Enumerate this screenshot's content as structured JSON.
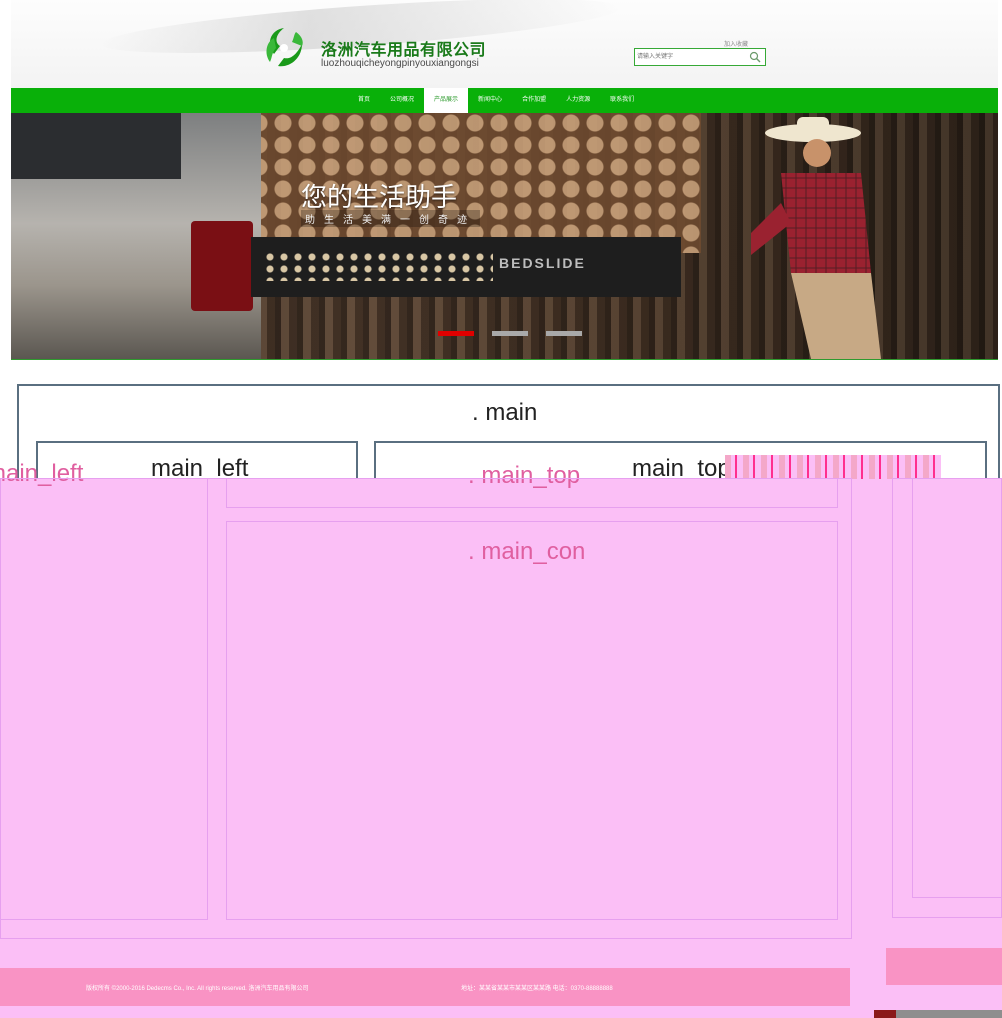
{
  "header": {
    "company_cn": "洛洲汽车用品有限公司",
    "company_en": "luozhouqicheyongpinyouxiangongsi",
    "top_link": "加入收藏",
    "search_placeholder": "请输入关键字"
  },
  "nav": {
    "items": [
      "首页",
      "公司概况",
      "产品展示",
      "新闻中心",
      "合作加盟",
      "人力资源",
      "联系我们"
    ],
    "active_index": 2
  },
  "banner": {
    "slogan": "您的生活助手",
    "subslogan": "助生活美满一创奇迹",
    "product_brand": "BEDSLIDE",
    "slides": 3,
    "active_slide": 0
  },
  "debug": {
    "main_label": ". main",
    "left_label": "main_left",
    "top_label": "main_top",
    "pink_left_label": "main_left",
    "pink_top_label": ". main_top",
    "pink_con_label": ". main_con"
  },
  "footer": {
    "copyright": "版权所有 ©2000-2016 Dedecms Co., Inc. All rights reserved. 洛洲汽车用品有限公司",
    "contact": "地址：某某省某某市某某区某某路 电话：0370-88888888"
  },
  "colors": {
    "nav_green": "#09b009",
    "brand_green": "#1a7a1a",
    "debug_pink": "#fbbff6",
    "footer_pink": "#f993c4",
    "active_dot": "#e00000"
  }
}
